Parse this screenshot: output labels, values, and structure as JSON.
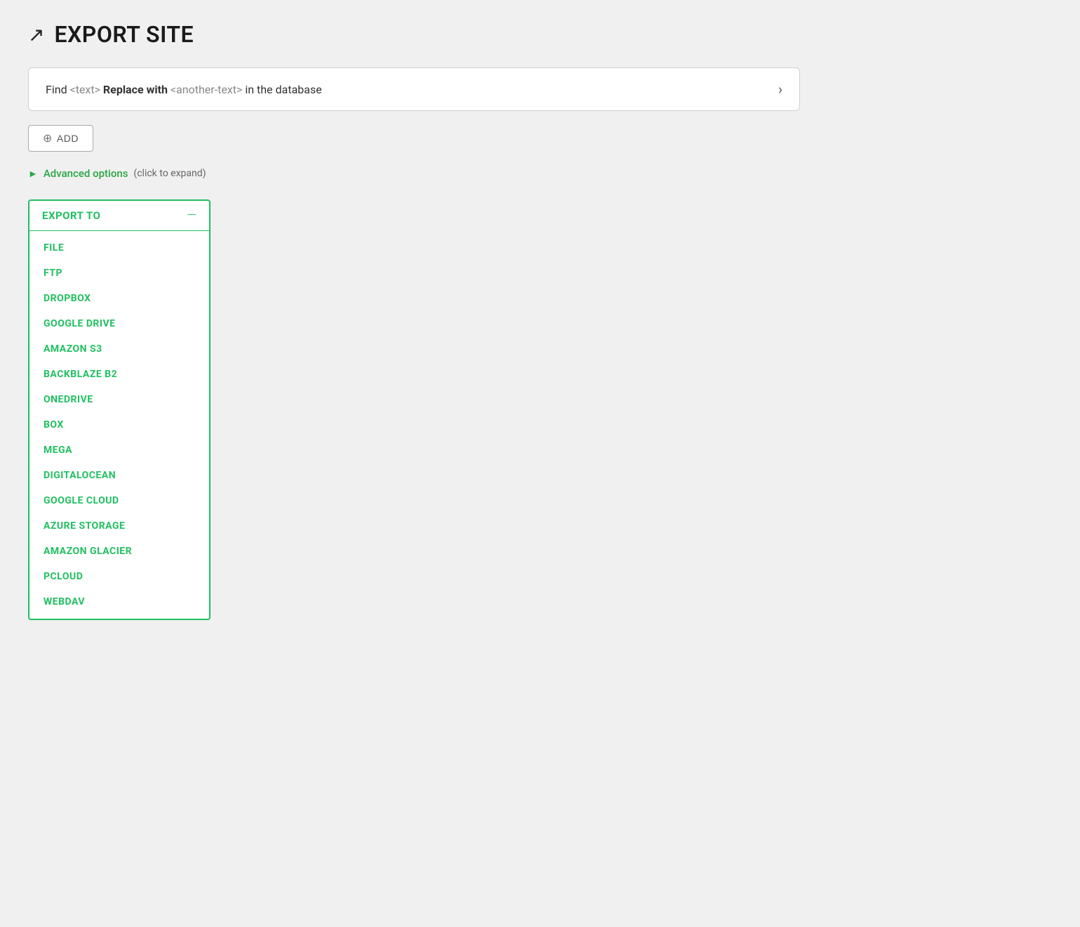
{
  "header": {
    "icon": "↗",
    "title": "EXPORT SITE"
  },
  "findReplace": {
    "prefix": "Find",
    "tag1": "<text>",
    "bold": "Replace with",
    "tag2": "<another-text>",
    "suffix": "in the database"
  },
  "addButton": {
    "label": "ADD",
    "plusIcon": "⊕"
  },
  "advancedOptions": {
    "label": "Advanced options",
    "hint": "(click to expand)"
  },
  "exportPanel": {
    "title": "EXPORT TO",
    "collapseIcon": "—",
    "items": [
      "FILE",
      "FTP",
      "DROPBOX",
      "GOOGLE DRIVE",
      "AMAZON S3",
      "BACKBLAZE B2",
      "ONEDRIVE",
      "BOX",
      "MEGA",
      "DIGITALOCEAN",
      "GOOGLE CLOUD",
      "AZURE STORAGE",
      "AMAZON GLACIER",
      "PCLOUD",
      "WEBDAV"
    ]
  }
}
